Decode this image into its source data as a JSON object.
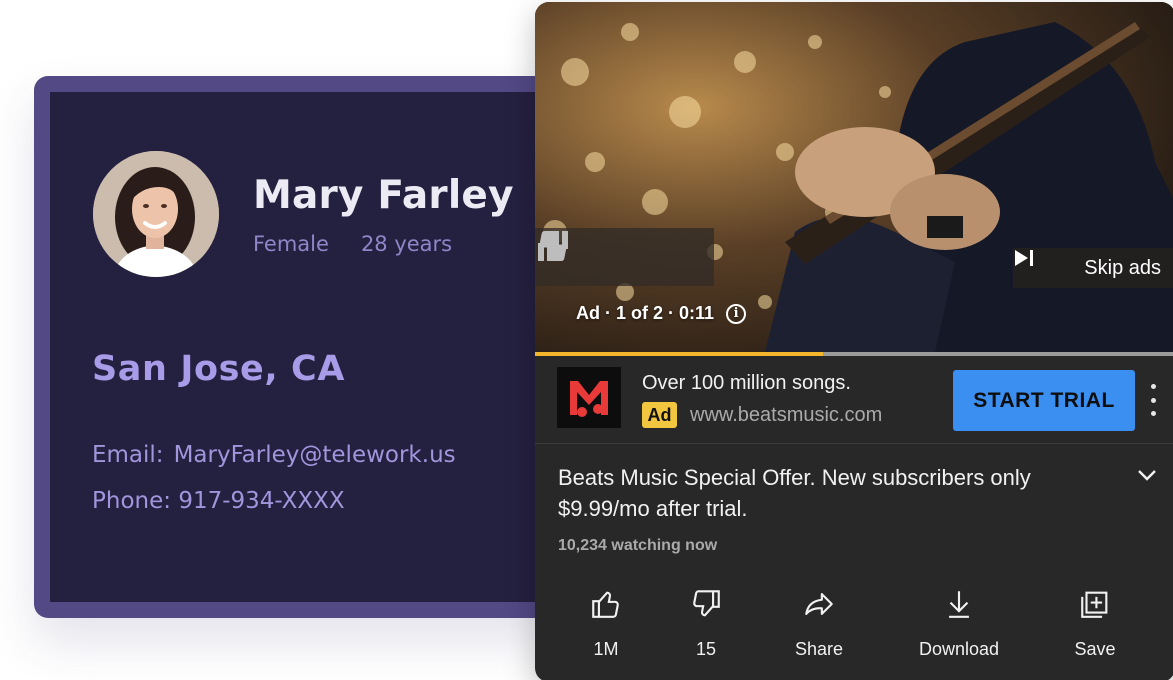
{
  "profile": {
    "name": "Mary Farley",
    "gender": "Female",
    "age": "28 years",
    "city": "San Jose, CA",
    "email_label": "Email:",
    "email": "MaryFarley@telework.us",
    "phone_label": "Phone:",
    "phone": "917-934-XXXX"
  },
  "video": {
    "skip_label": "Skip ads",
    "ad_info": "Ad · 1 of 2 · 0:11",
    "progress": 0.45
  },
  "ad": {
    "headline": "Over 100 million songs.",
    "badge": "Ad",
    "url": "www.beatsmusic.com",
    "cta": "START TRIAL"
  },
  "description": "Beats Music Special Offer. New subscribers only $9.99/mo after trial.",
  "watching": "10,234 watching now",
  "actions": {
    "like": "1M",
    "dislike": "15",
    "share": "Share",
    "download": "Download",
    "save": "Save"
  },
  "colors": {
    "card_border": "#524985",
    "card_bg": "#242040",
    "accent_blue": "#3a8ff0",
    "ad_badge": "#f3c63f",
    "progress": "#f2b52c"
  }
}
